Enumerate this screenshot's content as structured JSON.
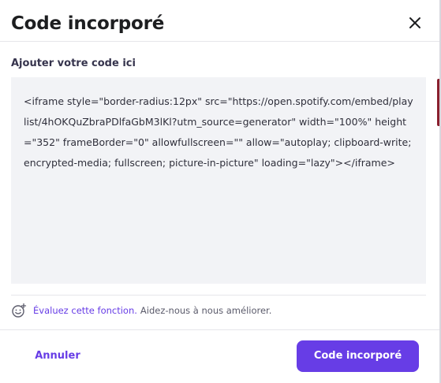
{
  "dialog": {
    "title": "Code incorporé",
    "close_icon": "close-icon"
  },
  "field": {
    "label": "Ajouter votre code ici",
    "value": "<iframe style=\"border-radius:12px\" src=\"https://open.spotify.com/embed/playlist/4hOKQuZbraPDlfaGbM3lKl?utm_source=generator\" width=\"100%\" height=\"352\" frameBorder=\"0\" allowfullscreen=\"\" allow=\"autoplay; clipboard-write; encrypted-media; fullscreen; picture-in-picture\" loading=\"lazy\"></iframe>"
  },
  "feedback": {
    "icon": "smiley-icon",
    "link": "Évaluez cette fonction.",
    "text": "Aidez-nous à nous améliorer."
  },
  "footer": {
    "cancel_label": "Annuler",
    "submit_label": "Code incorporé"
  },
  "colors": {
    "accent": "#673de6",
    "surface": "#f2f3f6",
    "text": "#1d1e20"
  }
}
